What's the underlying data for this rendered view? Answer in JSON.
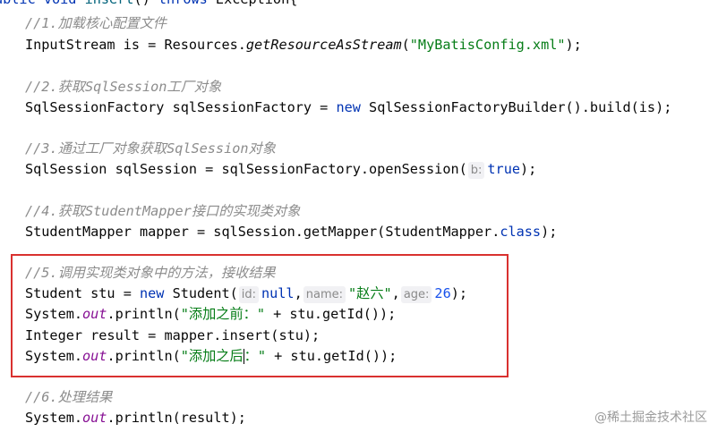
{
  "code": {
    "signature": {
      "prefix": "ublic void ",
      "method": "insert",
      "parens": "() ",
      "throws": "throws",
      "rest": " Exception{"
    },
    "c1": "//1.加载核心配置文件",
    "l1": {
      "a": "InputStream is = Resources.",
      "static_call": "getResourceAsStream",
      "b": "(",
      "str": "\"MyBatisConfig.xml\"",
      "c": ");"
    },
    "c2": "//2.获取SqlSession工厂对象",
    "l2": {
      "a": "SqlSessionFactory sqlSessionFactory = ",
      "kw": "new",
      "b": " SqlSessionFactoryBuilder().build(is);"
    },
    "c3": "//3.通过工厂对象获取SqlSession对象",
    "l3": {
      "a": "SqlSession sqlSession = sqlSessionFactory.openSession(",
      "hint": "b:",
      "kw": "true",
      "b": ");"
    },
    "c4": "//4.获取StudentMapper接口的实现类对象",
    "l4": {
      "a": "StudentMapper mapper = sqlSession.getMapper(StudentMapper.",
      "kw": "class",
      "b": ");"
    },
    "c5": "//5.调用实现类对象中的方法，接收结果",
    "l5": {
      "a": "Student stu = ",
      "kw": "new",
      "b": " Student(",
      "hint_id": "id:",
      "null": "null",
      "sep1": ",",
      "hint_name": "name:",
      "str": "\"赵六\"",
      "sep2": ",",
      "hint_age": "age:",
      "num": "26",
      "end": ");"
    },
    "l6": {
      "a": "System.",
      "field": "out",
      "b": ".println(",
      "str": "\"添加之前：\"",
      "c": " + stu.getId());"
    },
    "l7": "Integer result = mapper.insert(stu);",
    "l8": {
      "a": "System.",
      "field": "out",
      "b": ".println(",
      "str1": "\"添加之后",
      "str2": "：\"",
      "c": " + stu.getId());"
    },
    "c6": "//6.处理结果",
    "l9": {
      "a": "System.",
      "field": "out",
      "b": ".println(result);"
    }
  },
  "watermark": "@稀土掘金技术社区",
  "colors": {
    "keyword": "#0033b3",
    "comment": "#8c8c8c",
    "string": "#067d17",
    "field": "#871094",
    "number": "#1750eb",
    "highlight_box": "#d9312f"
  }
}
